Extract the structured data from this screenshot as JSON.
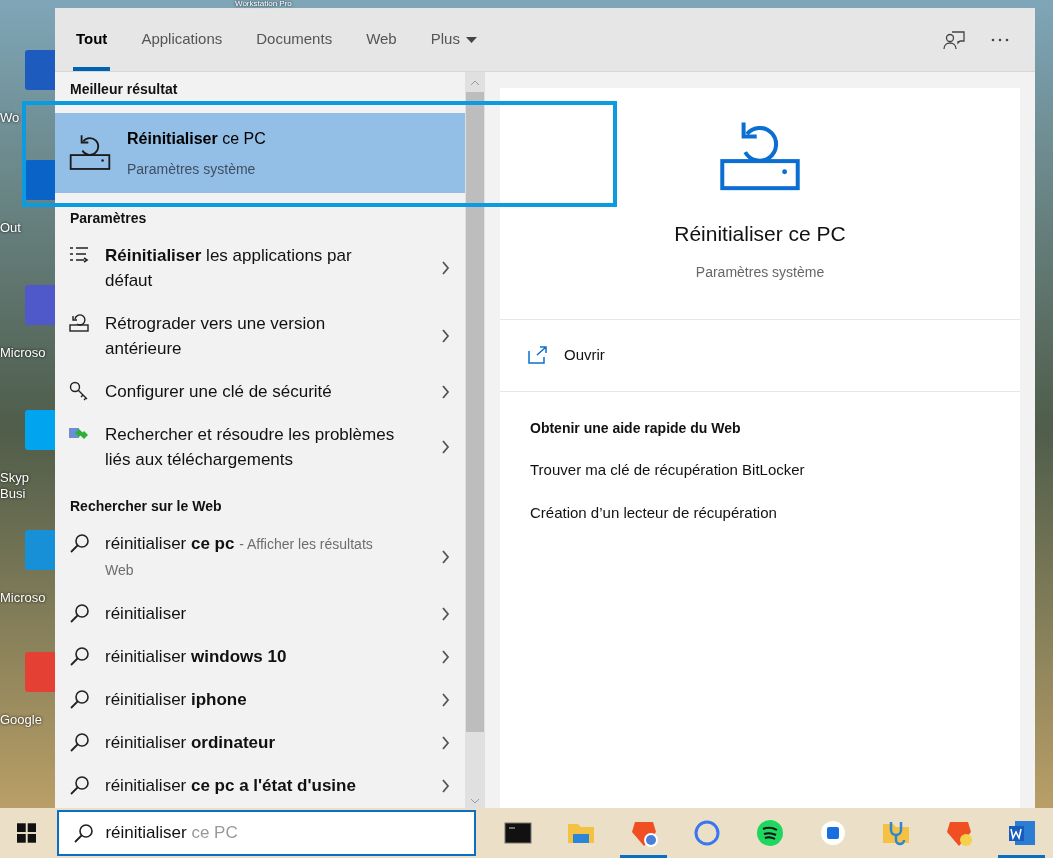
{
  "desktop_icons": [
    {
      "label": "Workstation Pro"
    },
    {
      "label": "Wo"
    },
    {
      "label": "Out"
    },
    {
      "label": "Microso"
    },
    {
      "label": "Skyp Busi"
    },
    {
      "label": "Microso"
    },
    {
      "label": "Google"
    }
  ],
  "tabs": [
    {
      "label": "Tout",
      "selected": true
    },
    {
      "label": "Applications",
      "selected": false
    },
    {
      "label": "Documents",
      "selected": false
    },
    {
      "label": "Web",
      "selected": false
    },
    {
      "label": "Plus",
      "selected": false,
      "dropdown": true
    }
  ],
  "best": {
    "heading": "Meilleur résultat",
    "title": "**Réinitialiser** ce PC",
    "subtitle": "Paramètres système",
    "selected": true
  },
  "settings": {
    "heading": "Paramètres",
    "items": [
      {
        "kind": "list",
        "text": "**Réinitialiser** les applications par défaut"
      },
      {
        "kind": "rollback",
        "text": "Rétrograder vers une version antérieure"
      },
      {
        "kind": "key",
        "text": "Configurer une clé de sécurité"
      },
      {
        "kind": "troubleshoot",
        "text": "Rechercher et résoudre les problèmes liés aux téléchargements"
      }
    ]
  },
  "web": {
    "heading": "Rechercher sur le Web",
    "items": [
      {
        "text": "réinitialiser **ce pc**",
        "suffix": "- Afficher les résultats Web"
      },
      {
        "text": "réinitialiser"
      },
      {
        "text": "réinitialiser **windows 10**"
      },
      {
        "text": "réinitialiser **iphone**"
      },
      {
        "text": "réinitialiser **ordinateur**"
      },
      {
        "text": "réinitialiser **ce pc a l'état d'usine**"
      }
    ]
  },
  "preview": {
    "title": "Réinitialiser ce PC",
    "subtitle": "Paramètres système",
    "action": "Ouvrir",
    "help_heading": "Obtenir une aide rapide du Web",
    "links": [
      "Trouver ma clé de récupération BitLocker",
      "Création d’un lecteur de récupération"
    ]
  },
  "search_box": {
    "value": "réinitialiser",
    "suggestion": "ce PC"
  },
  "taskbar": [
    {
      "kind": "terminal",
      "active": false
    },
    {
      "kind": "folder",
      "active": false
    },
    {
      "kind": "browser",
      "active": true
    },
    {
      "kind": "chat",
      "active": false
    },
    {
      "kind": "music",
      "active": false
    },
    {
      "kind": "app",
      "active": false
    },
    {
      "kind": "health",
      "active": false
    },
    {
      "kind": "browser2",
      "active": false
    },
    {
      "kind": "word",
      "active": true
    }
  ]
}
